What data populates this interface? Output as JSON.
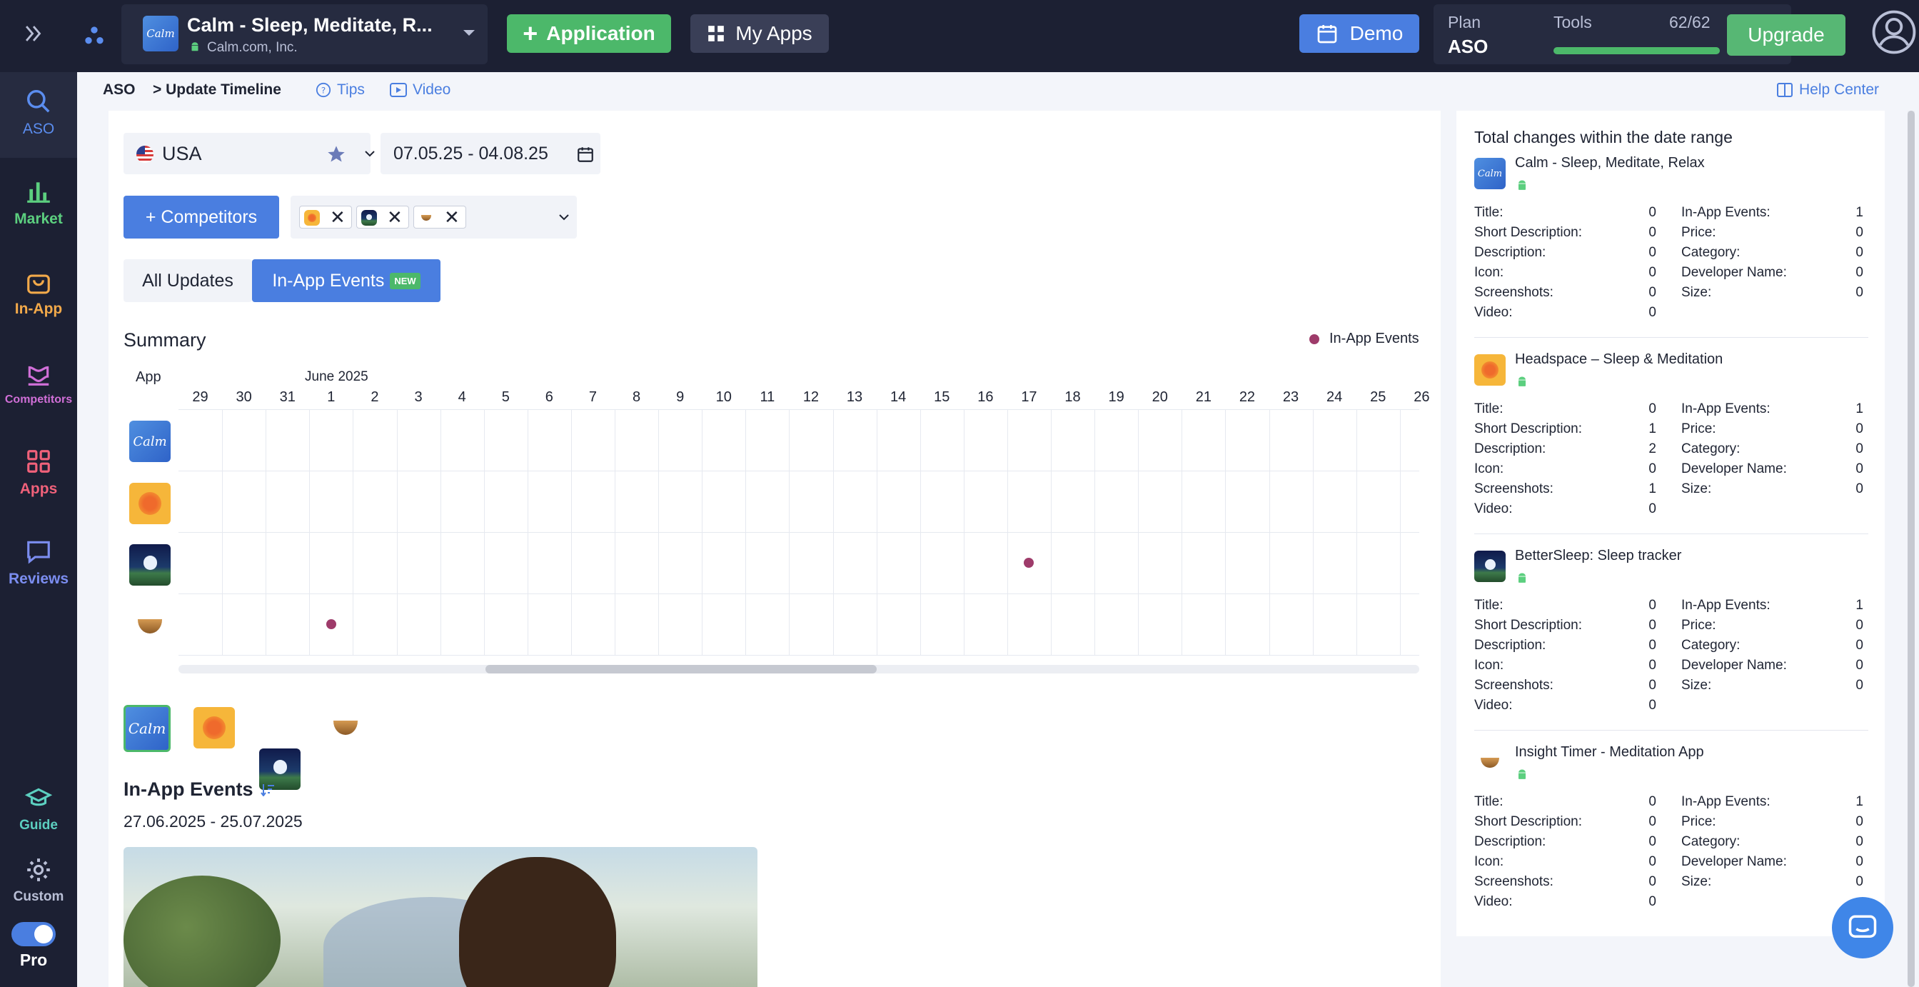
{
  "topbar": {
    "app_name": "Calm - Sleep, Meditate, R...",
    "app_developer": "Calm.com, Inc.",
    "application_btn": "Application",
    "my_apps_btn": "My Apps",
    "demo_btn": "Demo",
    "plan_label": "Plan",
    "plan_value": "ASO",
    "tools_label": "Tools",
    "tools_count": "62/62",
    "tools_progress": 1.0,
    "upgrade_btn": "Upgrade"
  },
  "sidebar": {
    "items": [
      {
        "label": "ASO",
        "icon": "search-icon",
        "color": "#5b8def"
      },
      {
        "label": "Market",
        "icon": "bar-chart-icon",
        "color": "#5ccf7f"
      },
      {
        "label": "In-App",
        "icon": "shopping-bag-icon",
        "color": "#f2a94a"
      },
      {
        "label": "Competitors",
        "icon": "competitors-icon",
        "color": "#d16fd8"
      },
      {
        "label": "Apps",
        "icon": "grid-icon",
        "color": "#f0617a"
      },
      {
        "label": "Reviews",
        "icon": "chat-icon",
        "color": "#7b8df0"
      }
    ],
    "guide": "Guide",
    "custom": "Custom",
    "pro": "Pro"
  },
  "breadcrumb": {
    "root": "ASO",
    "current": "> Update Timeline",
    "tips": "Tips",
    "video": "Video",
    "help_center": "Help Center"
  },
  "filters": {
    "country": "USA",
    "date_range": "07.05.25 - 04.08.25",
    "competitors_btn": "+  Competitors"
  },
  "tabs": {
    "all_updates": "All Updates",
    "in_app_events": "In-App Events",
    "new_badge": "NEW"
  },
  "summary": {
    "title": "Summary",
    "legend": "In-App Events",
    "app_col": "App",
    "month": "June 2025",
    "days": [
      "29",
      "30",
      "31",
      "1",
      "2",
      "3",
      "4",
      "5",
      "6",
      "7",
      "8",
      "9",
      "10",
      "11",
      "12",
      "13",
      "14",
      "15",
      "16",
      "17",
      "18",
      "19",
      "20",
      "21",
      "22",
      "23",
      "24",
      "25",
      "26"
    ],
    "events": [
      {
        "app_row": 2,
        "day": "17"
      },
      {
        "app_row": 3,
        "day": "1"
      }
    ],
    "dot_color": "#9e3b6a"
  },
  "events_section": {
    "title": "In-App Events",
    "date_range": "27.06.2025 - 25.07.2025"
  },
  "right_panel": {
    "title": "Total changes within the date range",
    "left_labels": [
      "Title:",
      "Short Description:",
      "Description:",
      "Icon:",
      "Screenshots:",
      "Video:"
    ],
    "right_labels": [
      "In-App Events:",
      "Price:",
      "Category:",
      "Developer Name:",
      "Size:"
    ],
    "apps": [
      {
        "name": "Calm - Sleep, Meditate, Relax",
        "left": [
          "0",
          "0",
          "0",
          "0",
          "0",
          "0"
        ],
        "right": [
          "1",
          "0",
          "0",
          "0",
          "0"
        ]
      },
      {
        "name": "Headspace – Sleep & Meditation",
        "left": [
          "0",
          "1",
          "2",
          "0",
          "1",
          "0"
        ],
        "right": [
          "1",
          "0",
          "0",
          "0",
          "0"
        ]
      },
      {
        "name": "BetterSleep: Sleep tracker",
        "left": [
          "0",
          "0",
          "0",
          "0",
          "0",
          "0"
        ],
        "right": [
          "1",
          "0",
          "0",
          "0",
          "0"
        ]
      },
      {
        "name": "Insight Timer - Meditation App",
        "left": [
          "0",
          "0",
          "0",
          "0",
          "0",
          "0"
        ],
        "right": [
          "1",
          "0",
          "0",
          "0",
          "0"
        ]
      }
    ]
  }
}
